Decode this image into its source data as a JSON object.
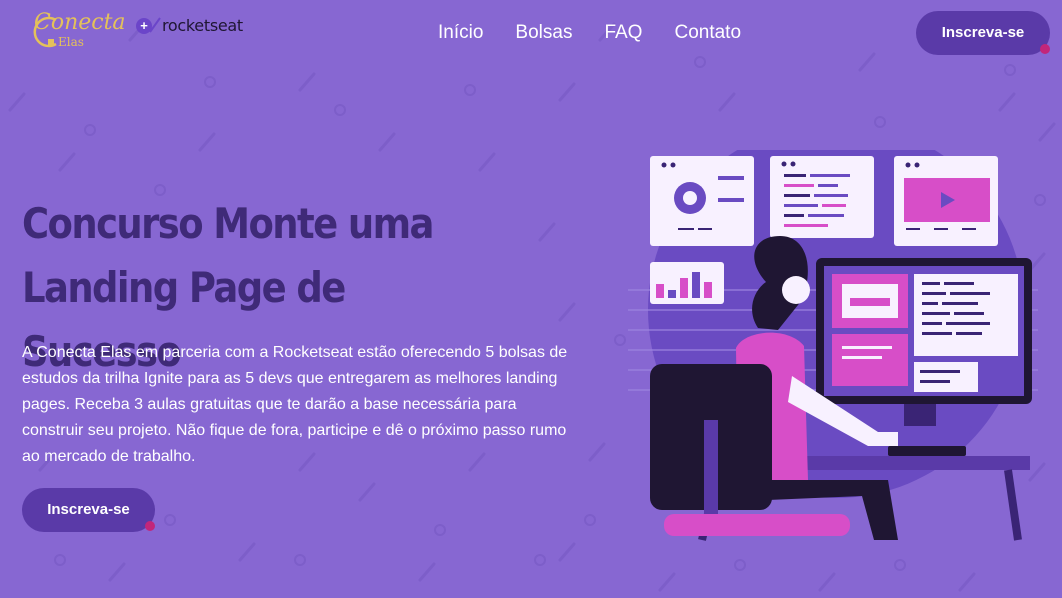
{
  "brand": {
    "logo_conecta": "Conecta",
    "logo_elas": "Elas",
    "logo_plus": "+",
    "logo_partner": "rocketseat"
  },
  "nav": {
    "items": [
      {
        "label": "Início"
      },
      {
        "label": "Bolsas"
      },
      {
        "label": "FAQ"
      },
      {
        "label": "Contato"
      }
    ]
  },
  "header": {
    "cta_label": "Inscreva-se"
  },
  "hero": {
    "title_line1": "Concurso Monte uma",
    "title_line2": "Landing Page de Sucesso",
    "description": "A Conecta Elas em parceria com a Rocketseat estão oferecendo 5 bolsas de estudos da trilha Ignite para as 5 devs que entregarem as melhores landing pages. Receba 3 aulas gratuitas que te darão a base necessária para construir seu projeto. Não fique de fora, participe e dê o próximo passo rumo ao mercado de trabalho.",
    "cta_label": "Inscreva-se"
  },
  "colors": {
    "background": "#8767d2",
    "button": "#5a3aa8",
    "accent_dot": "#c2267a",
    "title": "#3f2a78",
    "logo_gold": "#e4c15a"
  },
  "icons": [
    "plug-icon",
    "plus-icon",
    "rocket-icon"
  ]
}
